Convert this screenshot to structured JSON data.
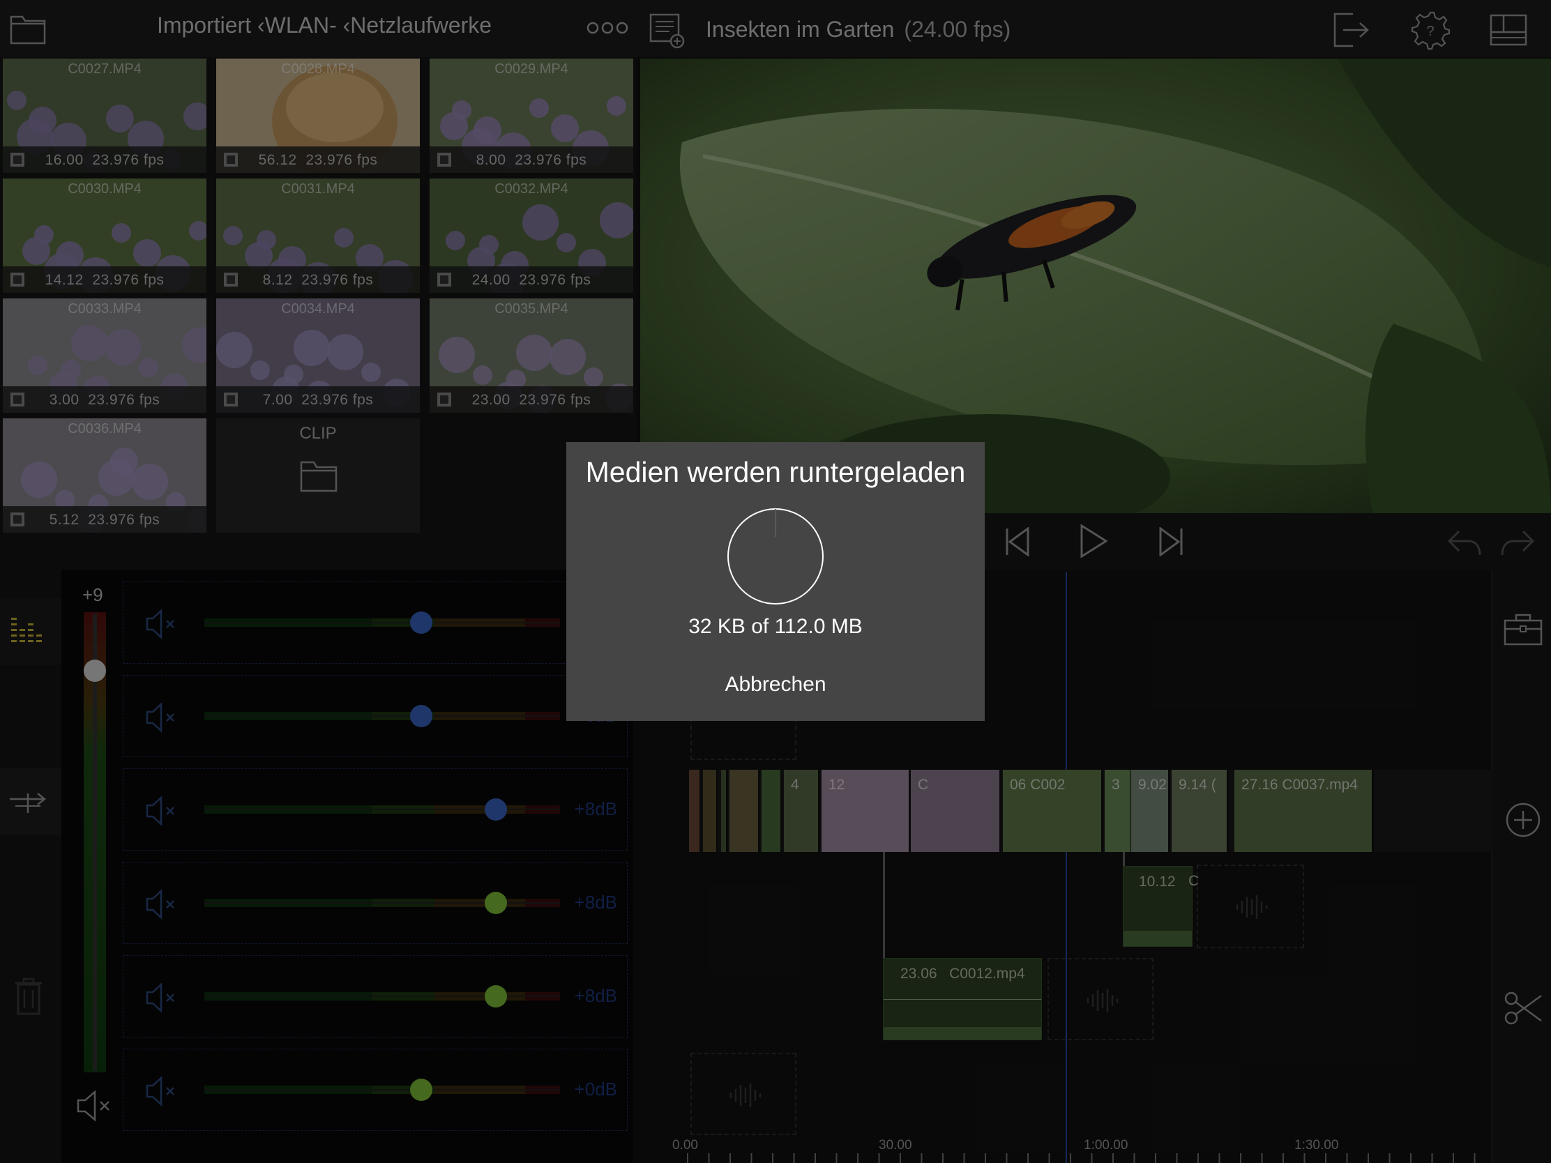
{
  "browser": {
    "breadcrumb": "Importiert ‹WLAN- ‹Netzlaufwerke",
    "clips": [
      {
        "name": "C0027.MP4",
        "duration": "16.00",
        "fps": "23.976 fps"
      },
      {
        "name": "C0028.MP4",
        "duration": "56.12",
        "fps": "23.976 fps"
      },
      {
        "name": "C0029.MP4",
        "duration": "8.00",
        "fps": "23.976 fps"
      },
      {
        "name": "C0030.MP4",
        "duration": "14.12",
        "fps": "23.976 fps"
      },
      {
        "name": "C0031.MP4",
        "duration": "8.12",
        "fps": "23.976 fps"
      },
      {
        "name": "C0032.MP4",
        "duration": "24.00",
        "fps": "23.976 fps"
      },
      {
        "name": "C0033.MP4",
        "duration": "3.00",
        "fps": "23.976 fps"
      },
      {
        "name": "C0034.MP4",
        "duration": "7.00",
        "fps": "23.976 fps"
      },
      {
        "name": "C0035.MP4",
        "duration": "23.00",
        "fps": "23.976 fps"
      },
      {
        "name": "C0036.MP4",
        "duration": "5.12",
        "fps": "23.976 fps"
      }
    ],
    "clip_folder_label": "CLIP"
  },
  "viewer": {
    "project_title": "Insekten im Garten",
    "project_fps": "(24.00 fps)"
  },
  "mixer": {
    "master_level_label": "+9",
    "tracks": [
      {
        "db": "",
        "knob_color": "#3a63c4",
        "knob_position": 0.61
      },
      {
        "db": "+0dB",
        "knob_color": "#3a63c4",
        "knob_position": 0.61
      },
      {
        "db": "+8dB",
        "knob_color": "#3a63c4",
        "knob_position": 0.82
      },
      {
        "db": "+8dB",
        "knob_color": "#7fbf3a",
        "knob_position": 0.82
      },
      {
        "db": "+8dB",
        "knob_color": "#7fbf3a",
        "knob_position": 0.82
      },
      {
        "db": "+0dB",
        "knob_color": "#7fbf3a",
        "knob_position": 0.61
      }
    ]
  },
  "timeline": {
    "video_clip_labels": [
      "4",
      "12",
      "C",
      "06 C002",
      "3",
      "9.02",
      "9.14 (",
      "27.16 C0037.mp4"
    ],
    "audio_clips": [
      {
        "duration": "10.12",
        "name": "C"
      },
      {
        "duration": "23.06",
        "name": "C0012.mp4"
      }
    ],
    "ruler": [
      "0.00",
      "30.00",
      "1:00.00",
      "1:30.00"
    ]
  },
  "dialog": {
    "title": "Medien werden runtergeladen",
    "progress_text": "32 KB of 112.0 MB",
    "progress_fraction": 0.0003,
    "cancel_label": "Abbrechen"
  },
  "icons": {
    "folder": "folder-icon",
    "more": "more-dots-icon",
    "media_list": "media-list-add-icon",
    "export": "export-icon",
    "settings_help": "settings-help-icon",
    "layout": "layout-icon",
    "accent_green": "#7fbf3a",
    "accent_blue": "#3a63c4"
  }
}
